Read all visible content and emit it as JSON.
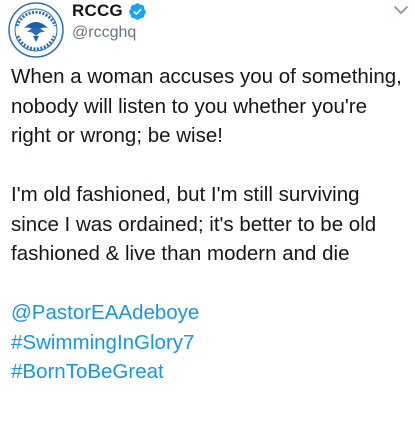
{
  "tweet": {
    "avatar_icon": "rccg-church-logo-icon",
    "display_name": "RCCG",
    "verified_icon": "verified-badge-icon",
    "handle": "@rccghq",
    "menu_icon": "chevron-down-icon",
    "paragraphs": [
      "When a woman accuses you of something, nobody will listen to you whether you're right or wrong; be wise!",
      "I'm old fashioned, but I'm still surviving since I was ordained; it's better to be old fashioned & live than modern and die"
    ],
    "mentions_and_tags": [
      "@PastorEAAdeboye",
      "#SwimmingInGlory7",
      "#BornToBeGreat"
    ]
  },
  "colors": {
    "text": "#14171a",
    "secondary_text": "#657786",
    "link": "#1b95e0",
    "verified": "#1da1f2",
    "logo_blue": "#1f5fa8"
  }
}
